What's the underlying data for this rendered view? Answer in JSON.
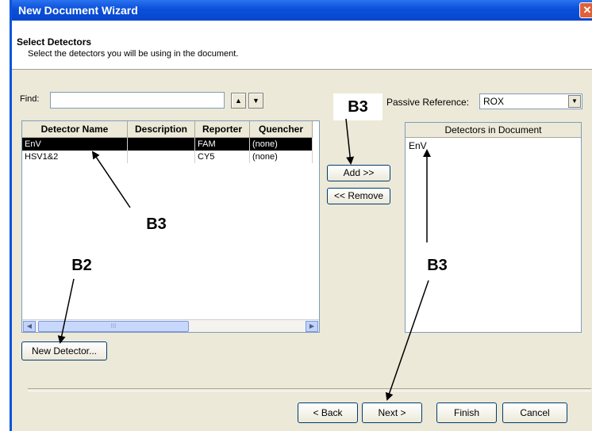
{
  "window": {
    "title": "New Document Wizard",
    "close_glyph": "✕"
  },
  "header": {
    "title": "Select Detectors",
    "subtitle": "Select the detectors you will be using in the document."
  },
  "find": {
    "label": "Find:",
    "value": "",
    "up_glyph": "▲",
    "down_glyph": "▼"
  },
  "passive_reference": {
    "label": "Passive Reference:",
    "value": "ROX",
    "dropdown_glyph": "▼"
  },
  "detector_table": {
    "columns": [
      "Detector Name",
      "Description",
      "Reporter",
      "Quencher"
    ],
    "rows": [
      {
        "name": "EnV",
        "description": "",
        "reporter": "FAM",
        "quencher": "(none)",
        "selected": true
      },
      {
        "name": "HSV1&2",
        "description": "",
        "reporter": "CY5",
        "quencher": "(none)",
        "selected": false
      }
    ],
    "hscroll": {
      "left_glyph": "◀",
      "right_glyph": "▶",
      "thumb_glyph": "III"
    }
  },
  "buttons": {
    "add": "Add >>",
    "remove": "<< Remove",
    "new_detector": "New Detector...",
    "back": "< Back",
    "next": "Next >",
    "finish": "Finish",
    "cancel": "Cancel"
  },
  "detectors_in_document": {
    "header": "Detectors in Document",
    "items": [
      "EnV"
    ]
  },
  "annotations": [
    "B3",
    "B3",
    "B2",
    "B3"
  ]
}
